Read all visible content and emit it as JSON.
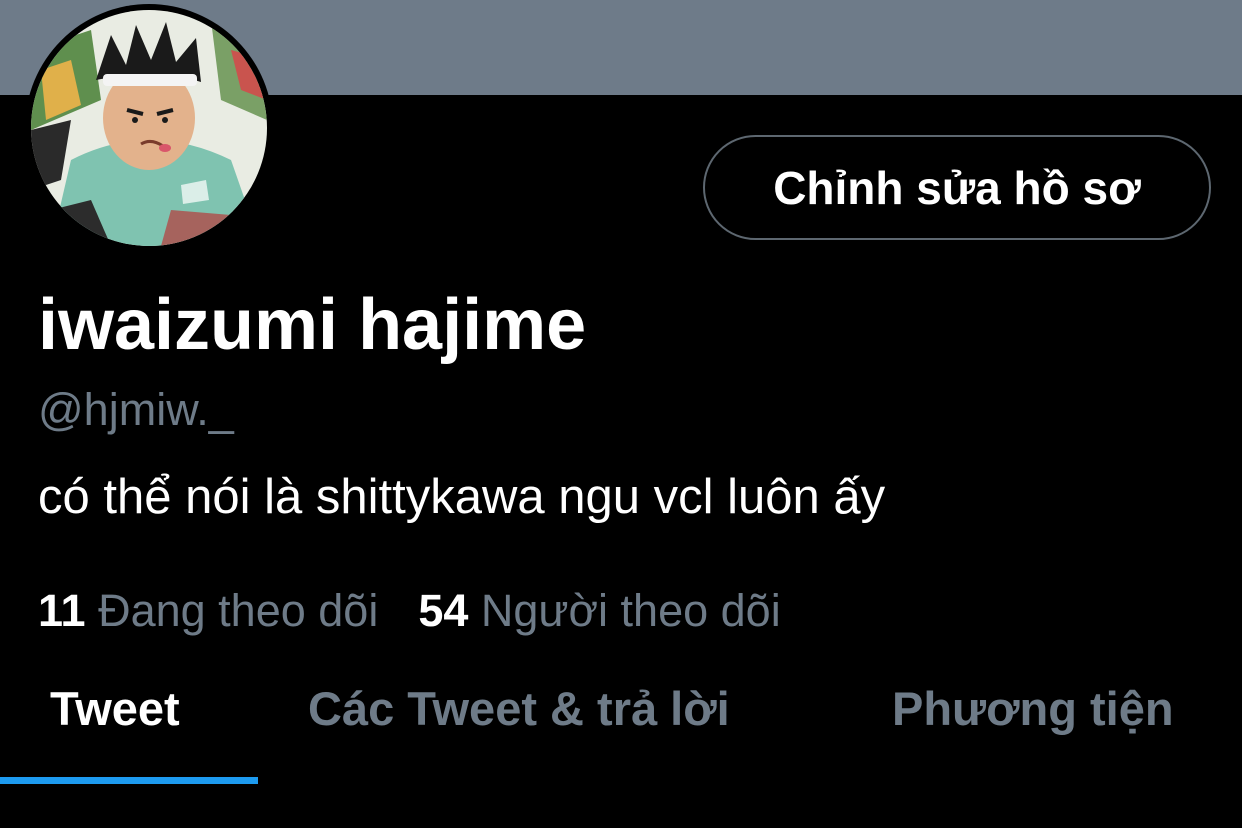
{
  "profile": {
    "display_name": "iwaizumi hajime",
    "handle": "@hjmiw._",
    "bio": "có thể nói là shittykawa ngu vcl luôn ấy",
    "edit_profile_label": "Chỉnh sửa hồ sơ",
    "avatar_icon": "profile-avatar"
  },
  "stats": {
    "following_count": "11",
    "following_label": "Đang theo dõi",
    "followers_count": "54",
    "followers_label": "Người theo dõi"
  },
  "tabs": [
    {
      "label": "Tweet",
      "active": true
    },
    {
      "label": "Các Tweet & trả lời",
      "active": false
    },
    {
      "label": "Phương tiện",
      "active": false
    }
  ],
  "colors": {
    "banner": "#6e7b89",
    "background": "#000000",
    "text_primary": "#ffffff",
    "text_secondary": "#6e7b88",
    "accent": "#1d9bf0",
    "button_border": "#5d6770"
  }
}
